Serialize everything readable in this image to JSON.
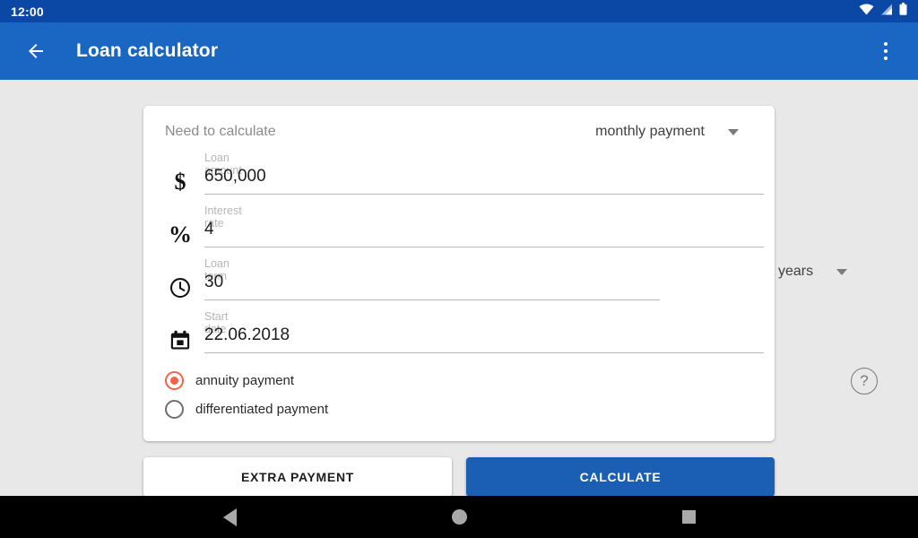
{
  "status_bar": {
    "clock": "12:00",
    "icons": [
      "wifi-icon",
      "cellular-signal-icon",
      "battery-icon"
    ]
  },
  "app_bar": {
    "back_icon": "back-arrow-icon",
    "title": "Loan calculator",
    "overflow_icon": "more-vert-icon",
    "background_color": "#1a66c3"
  },
  "card": {
    "header": {
      "label": "Need to calculate",
      "selected": "monthly payment",
      "dropdown_icon": "chevron-down-icon"
    },
    "fields": [
      {
        "icon": "dollar-icon",
        "glyph": "$",
        "label": "Loan amount",
        "value": "650,000"
      },
      {
        "icon": "percent-icon",
        "glyph": "%",
        "label": "Interest rate",
        "value": "4"
      },
      {
        "icon": "clock-icon",
        "glyph": "",
        "label": "Loan term",
        "value": "30"
      },
      {
        "icon": "calendar-icon",
        "glyph": "",
        "label": "Start date",
        "value": "22.06.2018"
      }
    ],
    "term_unit": {
      "selected": "years",
      "dropdown_icon": "chevron-down-icon"
    },
    "payment_type": {
      "selected": "annuity payment",
      "options": [
        {
          "label": "annuity payment",
          "selected": true
        },
        {
          "label": "differentiated payment",
          "selected": false
        }
      ],
      "accent_color": "#f4614a",
      "help_icon": "help-circle-icon",
      "help_glyph": "?"
    }
  },
  "actions": {
    "extra_payment_label": "EXTRA PAYMENT",
    "calculate_label": "CALCULATE",
    "calculate_color": "#1a5fb4"
  },
  "nav_bar": {
    "back_icon": "nav-back-icon",
    "home_icon": "nav-home-icon",
    "recents_icon": "nav-recents-icon"
  }
}
